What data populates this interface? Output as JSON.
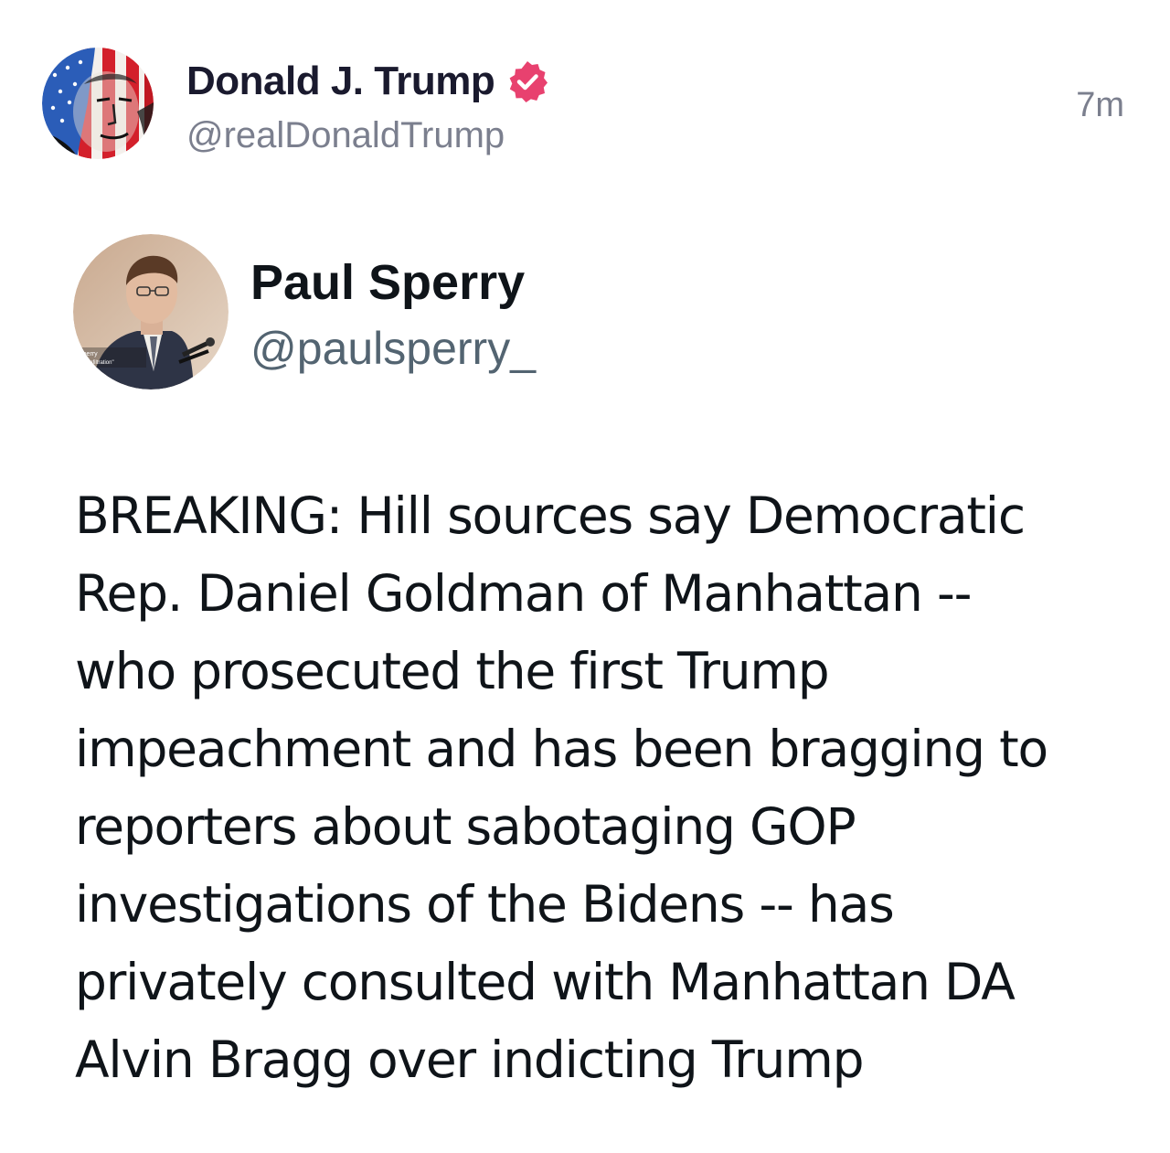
{
  "post": {
    "author_name": "Donald J. Trump",
    "author_handle": "@realDonaldTrump",
    "timestamp": "7m",
    "verified_color": "#e8416f"
  },
  "embedded_tweet": {
    "author_name": "Paul Sperry",
    "author_handle": "@paulsperry_",
    "text_lines": [
      "BREAKING: Hill sources say Democratic",
      "Rep. Daniel Goldman of Manhattan --",
      "who prosecuted the first Trump",
      "impeachment and has been bragging to",
      "reporters about sabotaging GOP",
      "investigations of the Bidens -- has",
      "privately consulted with Manhattan DA",
      "Alvin Bragg over indicting Trump"
    ]
  },
  "icons": {
    "verified": "verified-badge-icon"
  }
}
